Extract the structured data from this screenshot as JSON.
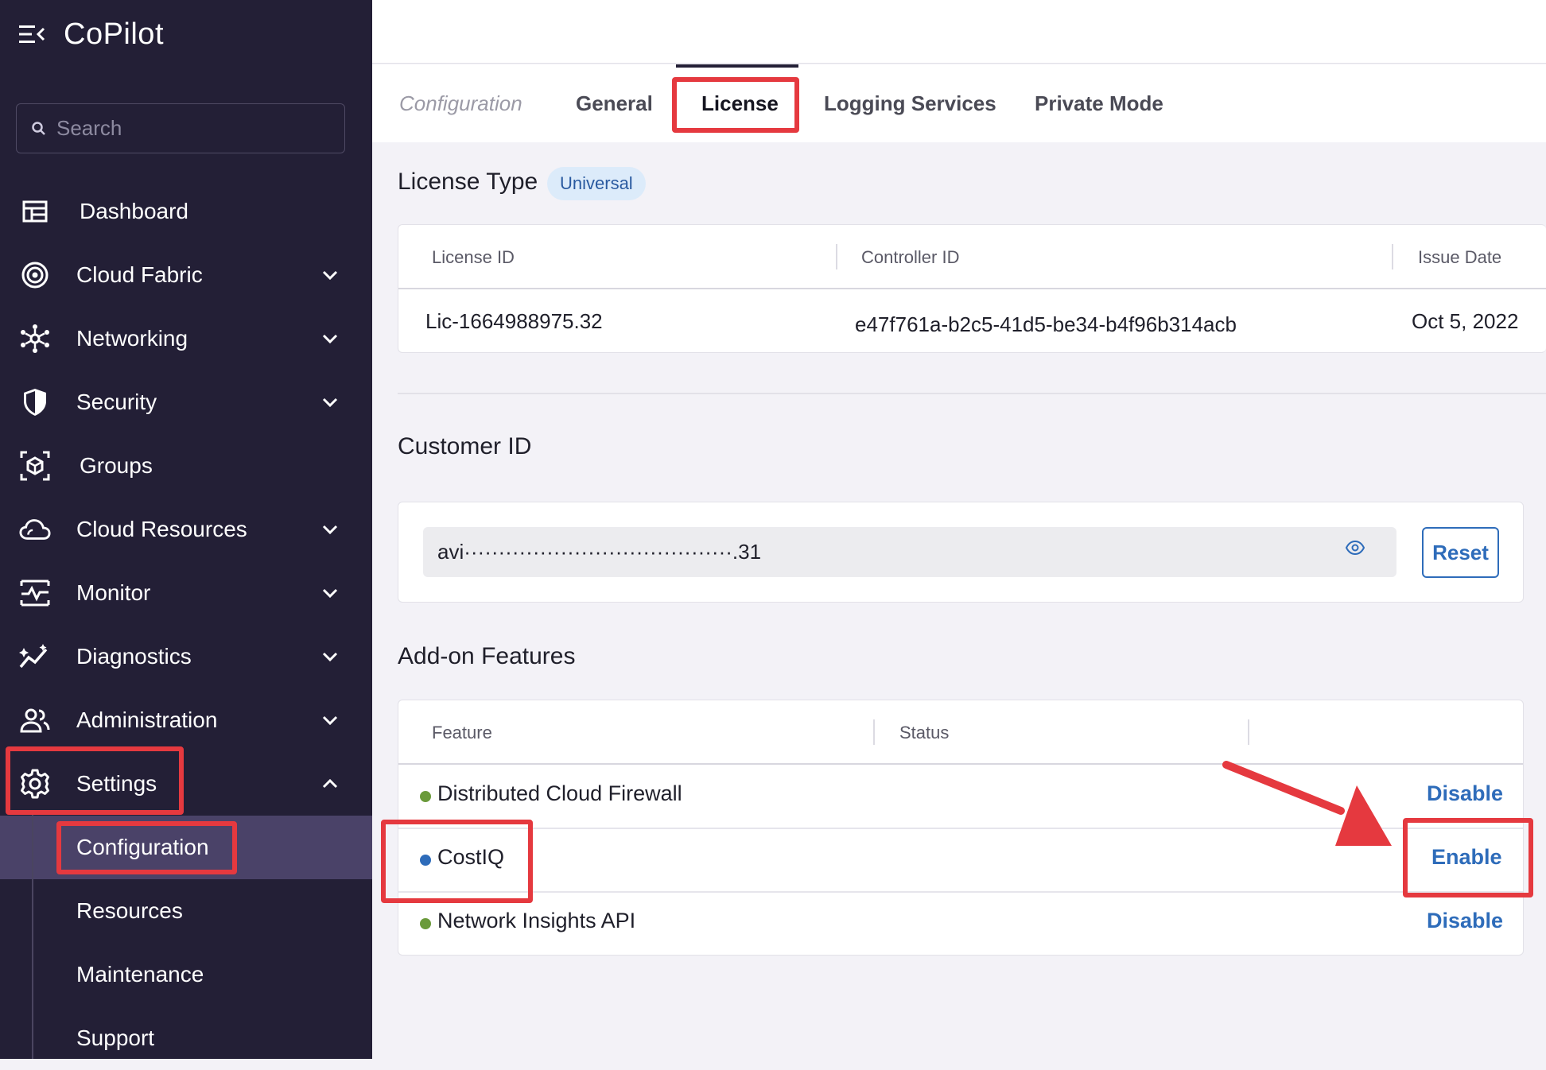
{
  "app": {
    "title": "CoPilot"
  },
  "search": {
    "placeholder": "Search"
  },
  "sidebar": {
    "items": [
      {
        "label": "Dashboard",
        "icon": "dashboard-icon",
        "expandable": false
      },
      {
        "label": "Cloud Fabric",
        "icon": "cloud-fabric-icon",
        "expandable": true
      },
      {
        "label": "Networking",
        "icon": "networking-icon",
        "expandable": true
      },
      {
        "label": "Security",
        "icon": "shield-icon",
        "expandable": true
      },
      {
        "label": "Groups",
        "icon": "groups-icon",
        "expandable": false
      },
      {
        "label": "Cloud Resources",
        "icon": "cloud-icon",
        "expandable": true
      },
      {
        "label": "Monitor",
        "icon": "monitor-icon",
        "expandable": true
      },
      {
        "label": "Diagnostics",
        "icon": "diagnostics-icon",
        "expandable": true
      },
      {
        "label": "Administration",
        "icon": "users-icon",
        "expandable": true
      },
      {
        "label": "Settings",
        "icon": "gear-icon",
        "expandable": true,
        "expanded": true
      }
    ],
    "settings_sub": [
      {
        "label": "Configuration",
        "active": true
      },
      {
        "label": "Resources"
      },
      {
        "label": "Maintenance"
      },
      {
        "label": "Support"
      }
    ]
  },
  "tabs": {
    "crumb": "Configuration",
    "items": [
      "General",
      "License",
      "Logging Services",
      "Private Mode"
    ],
    "active": "License"
  },
  "license": {
    "title": "License Type",
    "badge": "Universal",
    "headers": [
      "License ID",
      "Controller ID",
      "Issue Date"
    ],
    "row": [
      "Lic-1664988975.32",
      "e47f761a-b2c5-41d5-be34-b4f96b314acb",
      "Oct 5, 2022"
    ]
  },
  "customer": {
    "title": "Customer ID",
    "value": "avi·······································.31",
    "reset_label": "Reset"
  },
  "addons": {
    "title": "Add-on Features",
    "headers": [
      "Feature",
      "Status"
    ],
    "rows": [
      {
        "name": "Distributed Cloud Firewall",
        "action": "Disable",
        "dot": "#6a9a3a"
      },
      {
        "name": "CostIQ",
        "action": "Enable",
        "dot": "#2e6cba"
      },
      {
        "name": "Network Insights API",
        "action": "Disable",
        "dot": "#6a9a3a"
      }
    ]
  },
  "colors": {
    "sidebar": "#231f36",
    "accent": "#2e6cba",
    "highlight": "#e5393f"
  }
}
